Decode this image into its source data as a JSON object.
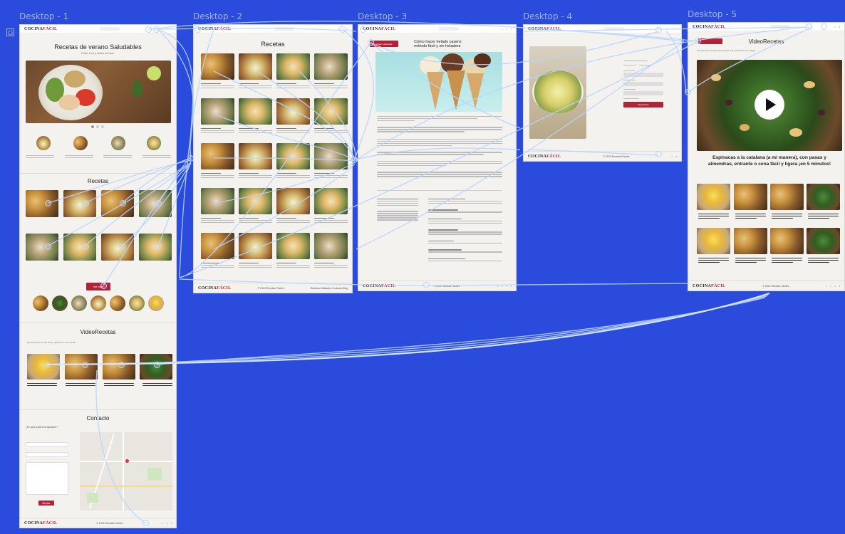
{
  "frames": [
    {
      "label": "Desktop - 1"
    },
    {
      "label": "Desktop - 2"
    },
    {
      "label": "Desktop - 3"
    },
    {
      "label": "Desktop - 4"
    },
    {
      "label": "Desktop - 5"
    }
  ],
  "brand": {
    "logo_a": "COCINA",
    "logo_b": "FÁCIL",
    "red": "#b2233a",
    "canvas_bg": "#2b4bdc",
    "link_color": "#b8d4ff"
  },
  "d1": {
    "hero_title": "Recetas de verano Saludables",
    "hero_sub": "Platos ricos y fáciles de hacer",
    "recipes_title": "Recetas",
    "ver_mas": "ver más",
    "video_title": "VideoRecetas",
    "video_sub": "Recetas para cocinar fácil y rápido con sus recetas",
    "contact_title": "Contacto",
    "contact_q": "¿En qué podemos ayudarte?",
    "send": "Enviar",
    "footer_copy": "© 2024 Recetas Fáciles"
  },
  "d2": {
    "title": "Recetas",
    "footer_copy": "© 2024 Recetas Fáciles",
    "footer_links": "Recetas  Utilidades  Contacto  Blog"
  },
  "d3": {
    "title": "Cómo hacer helado casero: método fácil y sin heladera",
    "button": "Volver a Recetas",
    "footer_copy": "© 2024 Recetas Fáciles"
  },
  "d4": {
    "login": "Registrarse",
    "footer_copy": "© 2024 Recetas Fáciles"
  },
  "d5": {
    "title": "VideoRecetas",
    "sub": "Recetas para cocinar paso a paso a la perfección en su hogar",
    "caption": "Espinacas a la catalana (a mi manera), con pasas y almendras, entrante o cena fácil y ligera ¡en 5 minutos!",
    "footer_copy": "© 2024 Recetas Fáciles"
  }
}
